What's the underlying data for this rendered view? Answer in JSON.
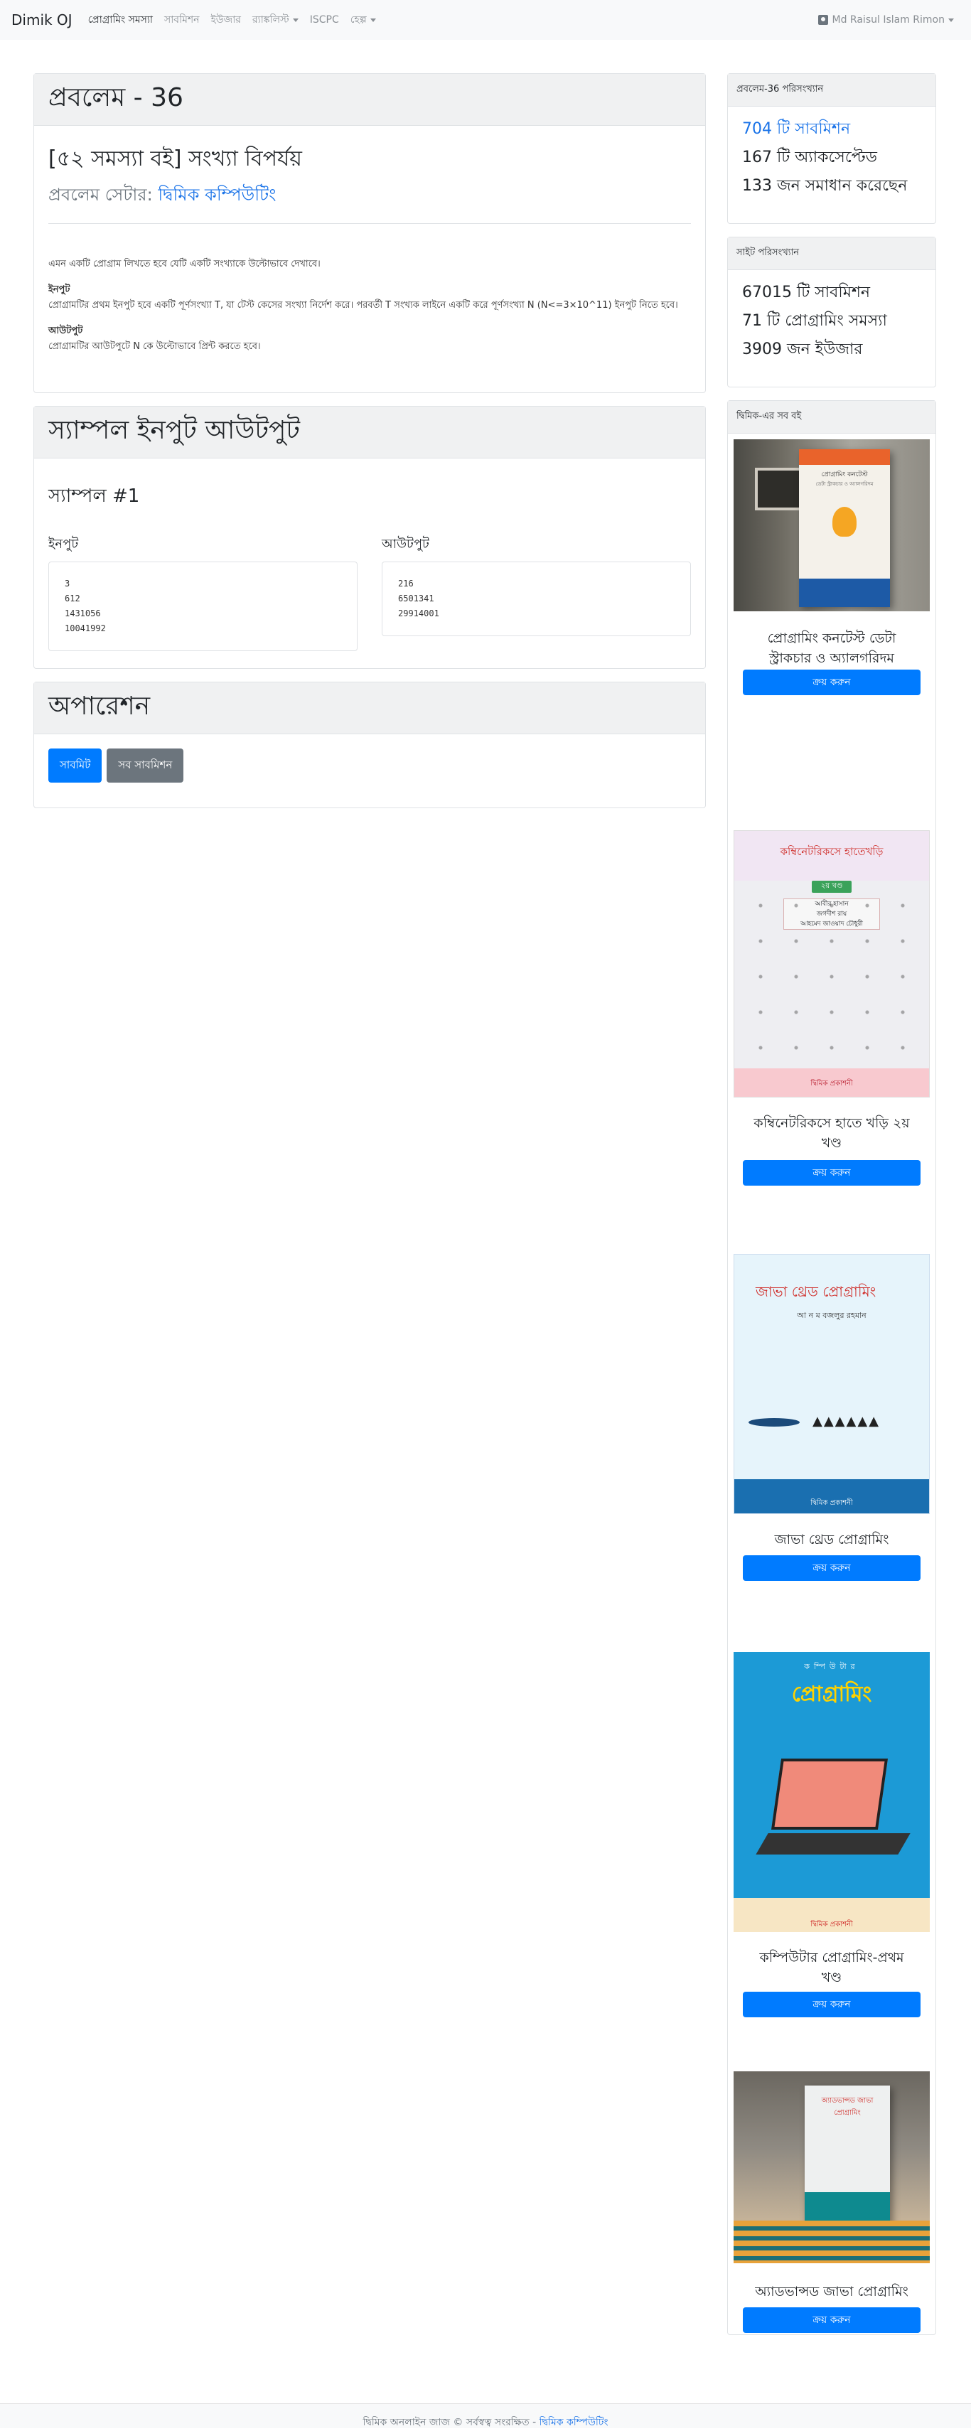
{
  "navbar": {
    "brand": "Dimik OJ",
    "items": [
      {
        "label": "প্রোগ্রামিং সমস্যা",
        "active": true
      },
      {
        "label": "সাবমিশন"
      },
      {
        "label": "ইউজার"
      },
      {
        "label": "র‍্যাঙ্কলিস্ট",
        "dropdown": true
      },
      {
        "label": "ISCPC"
      },
      {
        "label": "হেল্প",
        "dropdown": true
      }
    ],
    "user": "Md Raisul Islam Rimon"
  },
  "problem": {
    "header": "প্রবলেম - 36",
    "title": "[৫২ সমস্যা বই] সংখ্যা বিপর্যয়",
    "setter_prefix": "প্রবলেম সেটার:",
    "setter_name": "দ্বিমিক কম্পিউটিং",
    "statement": "এমন একটি প্রোগ্রাম লিখতে হবে যেটি একটি সংখ্যাকে উল্টোভাবে দেখাবে।",
    "input_heading": "ইনপুট",
    "input_text": "প্রোগ্রামটির প্রথম ইনপুট হবে একটি পূর্ণসংখ্যা T, যা টেস্ট কেসের সংখ্যা নির্দেশ করে। পরবর্তী T সংখ্যক লাইনে একটি করে পূর্ণসংখ্যা N (N<=3×10^11) ইনপুট নিতে হবে।",
    "output_heading": "আউটপুট",
    "output_text": "প্রোগ্রামটির আউটপুটে N কে উল্টোভাবে প্রিন্ট করতে হবে।"
  },
  "sample": {
    "header": "স্যাম্পল ইনপুট আউটপুট",
    "title": "স্যাম্পল #1",
    "input_label": "ইনপুট",
    "output_label": "আউটপুট",
    "input": "3\n612\n1431056\n10041992",
    "output": "216\n6501341\n29914001"
  },
  "operations": {
    "header": "অপারেশন",
    "submit": "সাবমিট",
    "all_submissions": "সব সাবমিশন"
  },
  "problem_stats": {
    "header": "প্রবলেম-36 পরিসংখ্যান",
    "submissions": "704 টি সাবমিশন",
    "accepted": "167 টি অ্যাকসেপ্টেড",
    "solved_by": "133 জন সমাধান করেছেন"
  },
  "site_stats": {
    "header": "সাইট পরিসংখ্যান",
    "submissions": "67015 টি সাবমিশন",
    "problems": "71 টি প্রোগ্রামিং সমস্যা",
    "users": "3909 জন ইউজার"
  },
  "books": {
    "header": "দ্বিমিক-এর সব বই",
    "buy_label": "ক্রয় করুন",
    "items": [
      {
        "name": "প্রোগ্রামিং কনটেস্ট ডেটা স্ট্রাকচার ও অ্যালগরিদম",
        "cover_title": "প্রোগ্রামিং কনটেস্ট",
        "cover_sub": "ডেটা স্ট্রাকচার ও অ্যালগরিদম"
      },
      {
        "name": "কম্বিনেটরিকসে হাতে খড়ি ২য় খণ্ড",
        "cover_title": "কম্বিনেটরিকসে হাতেখড়ি",
        "cover_sub": "২য় খণ্ড",
        "cover_authors": "আবীর হাসান\nজগদীশ রায়\nআহমেদ জাওয়াদ চৌধুরী"
      },
      {
        "name": "জাভা থ্রেড প্রোগ্রামিং",
        "cover_title": "জাভা থ্রেড প্রোগ্রামিং",
        "cover_sub": "আ ন ম বজলুর রহমান"
      },
      {
        "name": "কম্পিউটার প্রোগ্রামিং-প্রথম খণ্ড",
        "cover_title": "প্রোগ্রামিং",
        "cover_sub": "কম্পিউটার"
      },
      {
        "name": "অ্যাডভান্সড জাভা প্রোগ্রামিং",
        "cover_title": "অ্যাডভান্সড জাভা প্রোগ্রামিং",
        "cover_sub": ""
      }
    ],
    "publisher": "দ্বিমিক প্রকাশনী"
  },
  "footer": {
    "text": "দ্বিমিক অনলাইন জাজ © সর্বস্বত্ব সংরক্ষিত -",
    "link": "দ্বিমিক কম্পিউটিং"
  },
  "colors": {
    "primary": "#007bff",
    "secondary": "#6c757d",
    "link": "#1a73e8"
  }
}
